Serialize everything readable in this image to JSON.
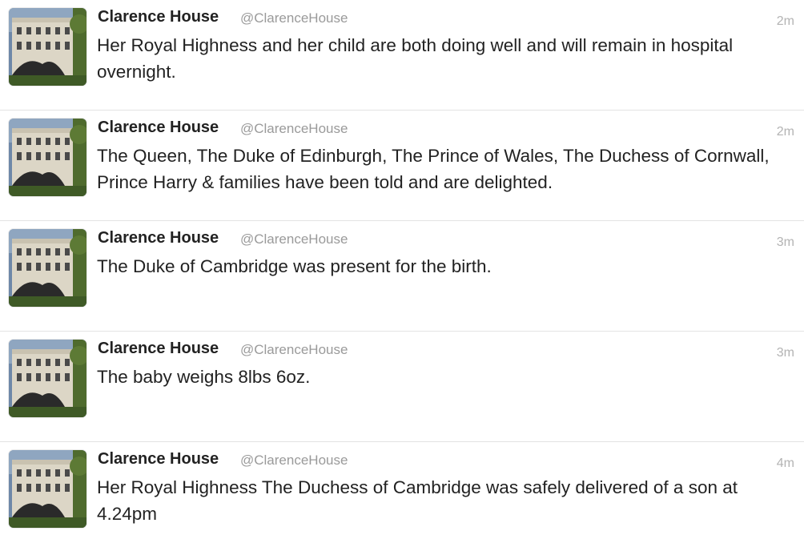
{
  "account": {
    "name": "Clarence House",
    "handle": "@ClarenceHouse"
  },
  "tweets": [
    {
      "time": "2m",
      "text": "Her Royal Highness and her child are both doing well and will remain in hospital overnight."
    },
    {
      "time": "2m",
      "text": "The Queen, The Duke of Edinburgh, The Prince of Wales, The Duchess of Cornwall, Prince Harry & families have been told and are delighted."
    },
    {
      "time": "3m",
      "text": "The Duke of Cambridge was present for the birth."
    },
    {
      "time": "3m",
      "text": "The baby weighs 8lbs 6oz."
    },
    {
      "time": "4m",
      "text": "Her Royal Highness The Duchess of Cambridge was safely delivered of a son at 4.24pm"
    }
  ]
}
